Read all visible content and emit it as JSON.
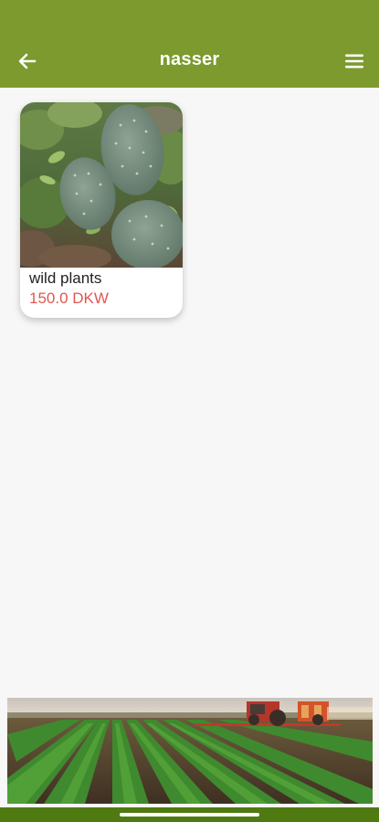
{
  "appbar": {
    "title": "nasser",
    "back_icon": "arrow-left-icon",
    "menu_icon": "hamburger-menu-icon"
  },
  "products": [
    {
      "name": "wild plants",
      "price": "150.0 DKW"
    }
  ],
  "colors": {
    "appbar": "#7c9a2d",
    "price": "#e0574f",
    "nav_strip": "#4f7a12"
  }
}
